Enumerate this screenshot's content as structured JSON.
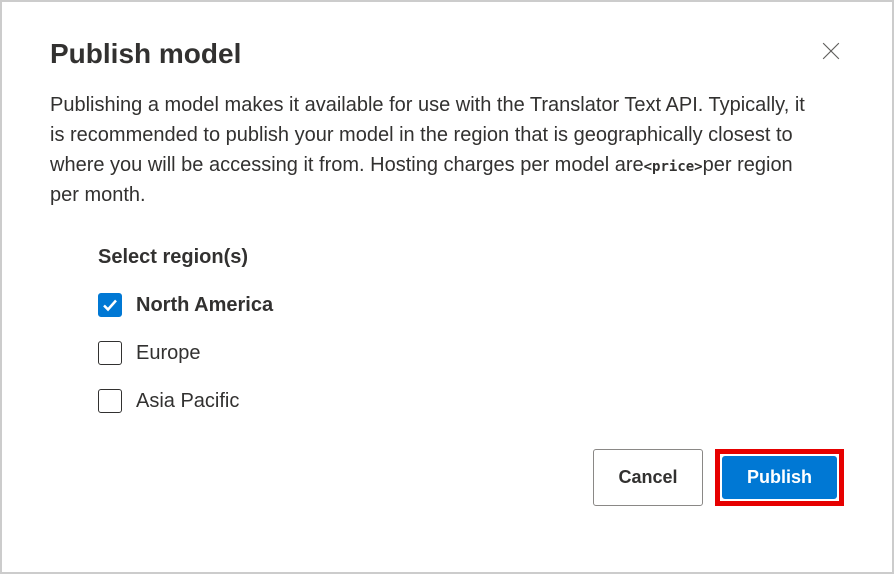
{
  "dialog": {
    "title": "Publish model",
    "description_prefix": "Publishing a model makes it available for use with the Translator Text API. Typically, it is recommended to publish your model in the region that is geographically closest to where you will be accessing it from. Hosting charges per model are",
    "price_placeholder": "<price>",
    "description_suffix": "per region per month."
  },
  "regions": {
    "section_label": "Select region(s)",
    "items": [
      {
        "label": "North America",
        "checked": true
      },
      {
        "label": "Europe",
        "checked": false
      },
      {
        "label": "Asia Pacific",
        "checked": false
      }
    ]
  },
  "footer": {
    "cancel_label": "Cancel",
    "publish_label": "Publish"
  }
}
